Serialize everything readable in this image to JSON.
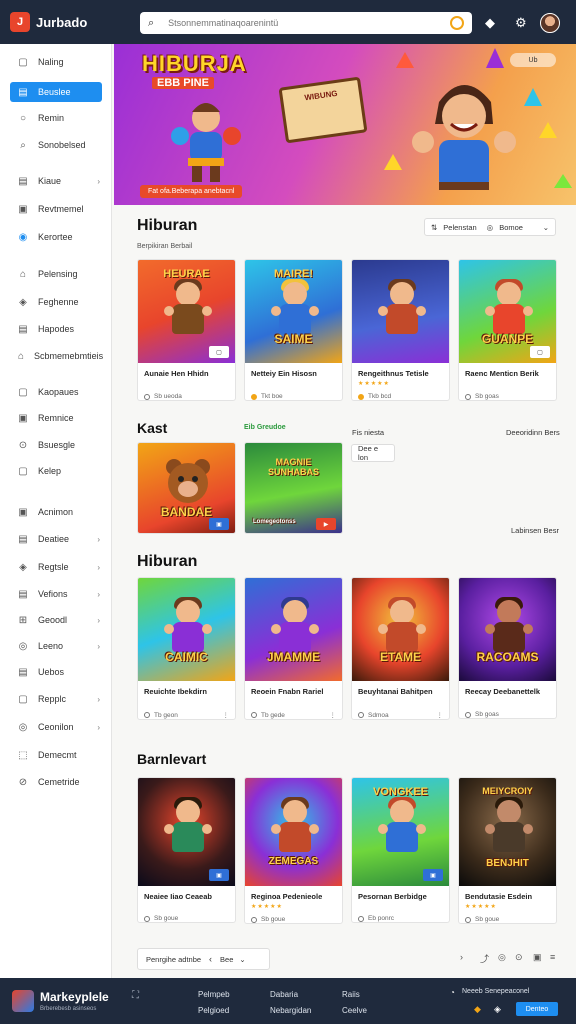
{
  "header": {
    "logo_letter": "J",
    "app_name": "Jurbado",
    "search_placeholder": "Stsonnemmatinaqoarenintü",
    "icons": [
      "search-icon",
      "gem-icon",
      "notifications-icon",
      "settings-icon",
      "avatar"
    ]
  },
  "sidebar": {
    "items": [
      {
        "label": "Naling",
        "icon": "▢"
      },
      {
        "label": "Beuslee",
        "icon": "▤"
      },
      {
        "label": "Remin",
        "icon": "○"
      },
      {
        "label": "Sonobelsed",
        "icon": "⌕"
      },
      {
        "label": "Kiaue",
        "icon": "▤"
      },
      {
        "label": "Revtmemel",
        "icon": "▣"
      },
      {
        "label": "Kerortee",
        "icon": "◉"
      },
      {
        "label": "Pelensing",
        "icon": "⌂"
      },
      {
        "label": "Feghenne",
        "icon": "◈"
      },
      {
        "label": "Hapodes",
        "icon": "▤"
      },
      {
        "label": "Scbmemebmtieis",
        "icon": "⌂"
      },
      {
        "label": "Kaopaues",
        "icon": "▢"
      },
      {
        "label": "Remnice",
        "icon": "▣"
      },
      {
        "label": "Bsuesgle",
        "icon": "⊙"
      },
      {
        "label": "Kelep",
        "icon": "▢"
      },
      {
        "label": "Acnimon",
        "icon": "▣"
      },
      {
        "label": "Deatiee",
        "icon": "▤"
      },
      {
        "label": "Regtsle",
        "icon": "◈"
      },
      {
        "label": "Vefions",
        "icon": "▤"
      },
      {
        "label": "Geoodl",
        "icon": "⊞"
      },
      {
        "label": "Leeno",
        "icon": "◎"
      },
      {
        "label": "Uebos",
        "icon": "▤"
      },
      {
        "label": "Repplc",
        "icon": "▢"
      },
      {
        "label": "Ceonilon",
        "icon": "◎"
      },
      {
        "label": "Demecmt",
        "icon": "⬚"
      },
      {
        "label": "Cemetride",
        "icon": "⊘"
      }
    ]
  },
  "hero": {
    "title": "HIBURJA",
    "subtitle": "EBB PINE",
    "board_text": "WIBUNG",
    "cta": "Fat ofa.Beberapa anebtacnl",
    "pill": "Ub"
  },
  "section1": {
    "title": "Hiburan",
    "subtitle": "Berpikiran Berbail",
    "filter1": "Pelenstan",
    "filter2": "Bomoe",
    "cards": [
      {
        "thumb_title": "HEURAE",
        "name": "Aunaie Hen Hhidn",
        "meta": "Sb ueoda",
        "badge": "▢"
      },
      {
        "thumb_title": "MAIRE!",
        "thumb_bottom": "SAIME",
        "name": "Netteiy Ein Hisosn",
        "meta": "Tkt boe",
        "badge": ""
      },
      {
        "thumb_title": "",
        "name": "Rengeithnus Tetisle",
        "meta": "Tkb bcd",
        "badge": ""
      },
      {
        "thumb_title": "",
        "thumb_bottom": "GUANPE",
        "name": "Raenc Menticn Berik",
        "meta": "Sb goas",
        "badge": "▢"
      }
    ]
  },
  "section2": {
    "title": "Kast",
    "tag": "Eib Greudoe",
    "link1": "Fis niesta",
    "link2": "Deeoridinn Bers",
    "button": "Dee e lon",
    "footer_link": "Labinsen Besr",
    "cards": [
      {
        "thumb_bottom": "BANDAE",
        "badge": "▣"
      },
      {
        "thumb_title": "MAGNIE SUNHABAS",
        "thumb_bottom": "Lomegeotonss"
      }
    ]
  },
  "section3": {
    "title": "Hiburan",
    "cards": [
      {
        "thumb_bottom": "CAIMIC",
        "name": "Reuichte Ibekdirn",
        "meta": "Tb geon"
      },
      {
        "thumb_bottom": "JMAMME",
        "name": "Reoein Fnabn Rariel",
        "meta": "Tb gede"
      },
      {
        "thumb_bottom": "ETAME",
        "name": "Beuyhtanai Bahitpen",
        "meta": "Sdmoa"
      },
      {
        "thumb_bottom": "RACOAMS",
        "name": "Reecay Deebanettelk",
        "meta": "Sb goas"
      }
    ]
  },
  "section4": {
    "title": "Barnlevart",
    "cards": [
      {
        "thumb_bottom": "",
        "name": "Neaiee Iiao Ceaeab",
        "meta": "Sb goue"
      },
      {
        "thumb_bottom": "ZEMEGAS",
        "name": "Reginoa Pedenieole",
        "meta": "Sb goue"
      },
      {
        "thumb_title": "VONGKEE",
        "name": "Pesornan Berbidge",
        "meta": "Eb ponrc"
      },
      {
        "thumb_title": "MEIYCROIY",
        "thumb_bottom": "BENJHIT",
        "name": "Bendutasie Esdein",
        "meta": "Sb goue"
      }
    ]
  },
  "pager": {
    "label": "Penrgihe adtnbe",
    "page": "Bee"
  },
  "footer": {
    "brand": "Markeyplele",
    "tagline": "Brberebesb asinseos",
    "links": [
      "Pelmpeb",
      "Dabaria",
      "Raiis",
      "Pelgioed",
      "Nebargidan",
      "Ceelve"
    ],
    "right_text": "Neeeb Senepeaconel",
    "button": "Denteo"
  }
}
